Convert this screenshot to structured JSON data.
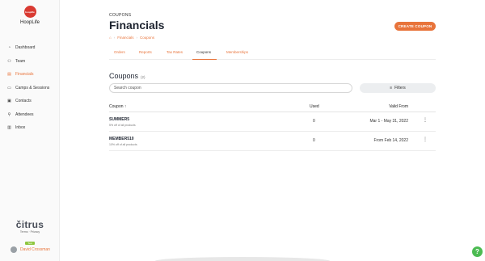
{
  "sidebar": {
    "org_name": "HoopLife",
    "logo_text": "hooplife",
    "items": [
      {
        "label": "Dashboard",
        "icon": "dashboard-icon"
      },
      {
        "label": "Team",
        "icon": "team-icon"
      },
      {
        "label": "Financials",
        "icon": "financials-icon",
        "active": true
      },
      {
        "label": "Camps & Sessions",
        "icon": "camps-icon"
      },
      {
        "label": "Contacts",
        "icon": "contacts-icon"
      },
      {
        "label": "Attendees",
        "icon": "attendees-icon"
      },
      {
        "label": "Inbox",
        "icon": "inbox-icon"
      }
    ],
    "brand": "čitrus",
    "terms": "Terms",
    "privacy": "Privacy",
    "badge": "Test",
    "user_name": "David Crossman"
  },
  "header": {
    "eyebrow": "COUPONS",
    "title": "Financials",
    "create_button": "CREATE COUPON",
    "breadcrumb": [
      "Financials",
      "Coupons"
    ]
  },
  "tabs": [
    {
      "label": "Orders"
    },
    {
      "label": "Reports"
    },
    {
      "label": "Tax Rates"
    },
    {
      "label": "Coupons",
      "active": true
    },
    {
      "label": "Memberships"
    }
  ],
  "coupons": {
    "title": "Coupons",
    "count": "(2)",
    "search_placeholder": "Search coupon",
    "filters_label": "Filters",
    "columns": {
      "coupon": "Coupon",
      "used": "Used",
      "valid_from": "Valid From"
    },
    "rows": [
      {
        "name": "SUMMER5",
        "desc": "5% off of all products",
        "used": "0",
        "valid": "Mar 1 - May 31, 2022"
      },
      {
        "name": "MEMBER510",
        "desc": "10% off of all products",
        "used": "0",
        "valid": "From Feb 14, 2022"
      }
    ]
  },
  "colors": {
    "accent": "#e8743b",
    "help": "#4cbb52",
    "logo": "#d93a32"
  }
}
